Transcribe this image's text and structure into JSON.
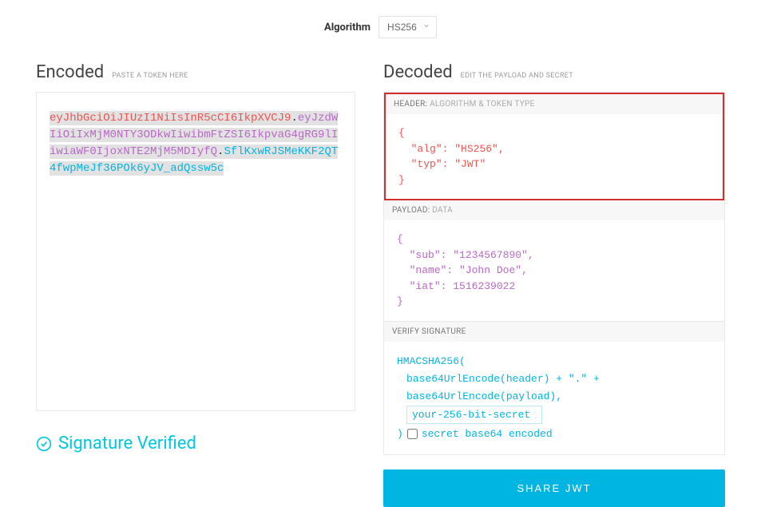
{
  "algorithm": {
    "label": "Algorithm",
    "selected": "HS256"
  },
  "encoded": {
    "title": "Encoded",
    "subtitle": "PASTE A TOKEN HERE",
    "header_part": "eyJhbGciOiJIUzI1NiIsInR5cCI6IkpXVCJ9",
    "payload_part": "eyJzdWIiOiIxMjM0NTY3ODkwIiwibmFtZSI6IkpvaG4gRG9lIiwiaWF0IjoxNTE2MjM5MDIyfQ",
    "signature_part": "SflKxwRJSMeKKF2QT4fwpMeJf36POk6yJV_adQssw5c"
  },
  "decoded": {
    "title": "Decoded",
    "subtitle": "EDIT THE PAYLOAD AND SECRET",
    "header_section": {
      "label": "HEADER:",
      "sublabel": "ALGORITHM & TOKEN TYPE",
      "alg_key": "\"alg\"",
      "alg_val": "\"HS256\"",
      "typ_key": "\"typ\"",
      "typ_val": "\"JWT\""
    },
    "payload_section": {
      "label": "PAYLOAD:",
      "sublabel": "DATA",
      "sub_key": "\"sub\"",
      "sub_val": "\"1234567890\"",
      "name_key": "\"name\"",
      "name_val": "\"John Doe\"",
      "iat_key": "\"iat\"",
      "iat_val": "1516239022"
    },
    "signature_section": {
      "label": "VERIFY SIGNATURE",
      "line1": "HMACSHA256(",
      "line2": "base64UrlEncode(header) + \".\" +",
      "line3": "base64UrlEncode(payload),",
      "secret_placeholder": "your-256-bit-secret",
      "close_paren": ")",
      "checkbox_label": "secret base64 encoded"
    }
  },
  "verified": "Signature Verified",
  "share_button": "SHARE JWT"
}
